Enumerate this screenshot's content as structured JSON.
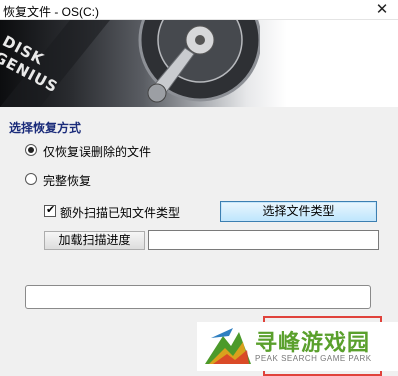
{
  "window": {
    "title": "恢复文件 - OS(C:)",
    "close_glyph": "✕"
  },
  "banner": {
    "logo_line1": "DISK",
    "logo_line2": "GENIUS"
  },
  "recovery": {
    "section_title": "选择恢复方式",
    "options": [
      {
        "label": "仅恢复误删除的文件",
        "selected": true
      },
      {
        "label": "完整恢复",
        "selected": false
      }
    ],
    "scan_known_types": {
      "label": "额外扫描已知文件类型",
      "checked": true
    },
    "select_types_button": "选择文件类型",
    "load_progress_button": "加载扫描进度",
    "progress_path_value": "",
    "status_value": ""
  },
  "watermark": {
    "name_cn": "寻峰游戏园",
    "name_en": "PEAK SEARCH GAME PARK",
    "brand_green": "#5aa02c"
  }
}
